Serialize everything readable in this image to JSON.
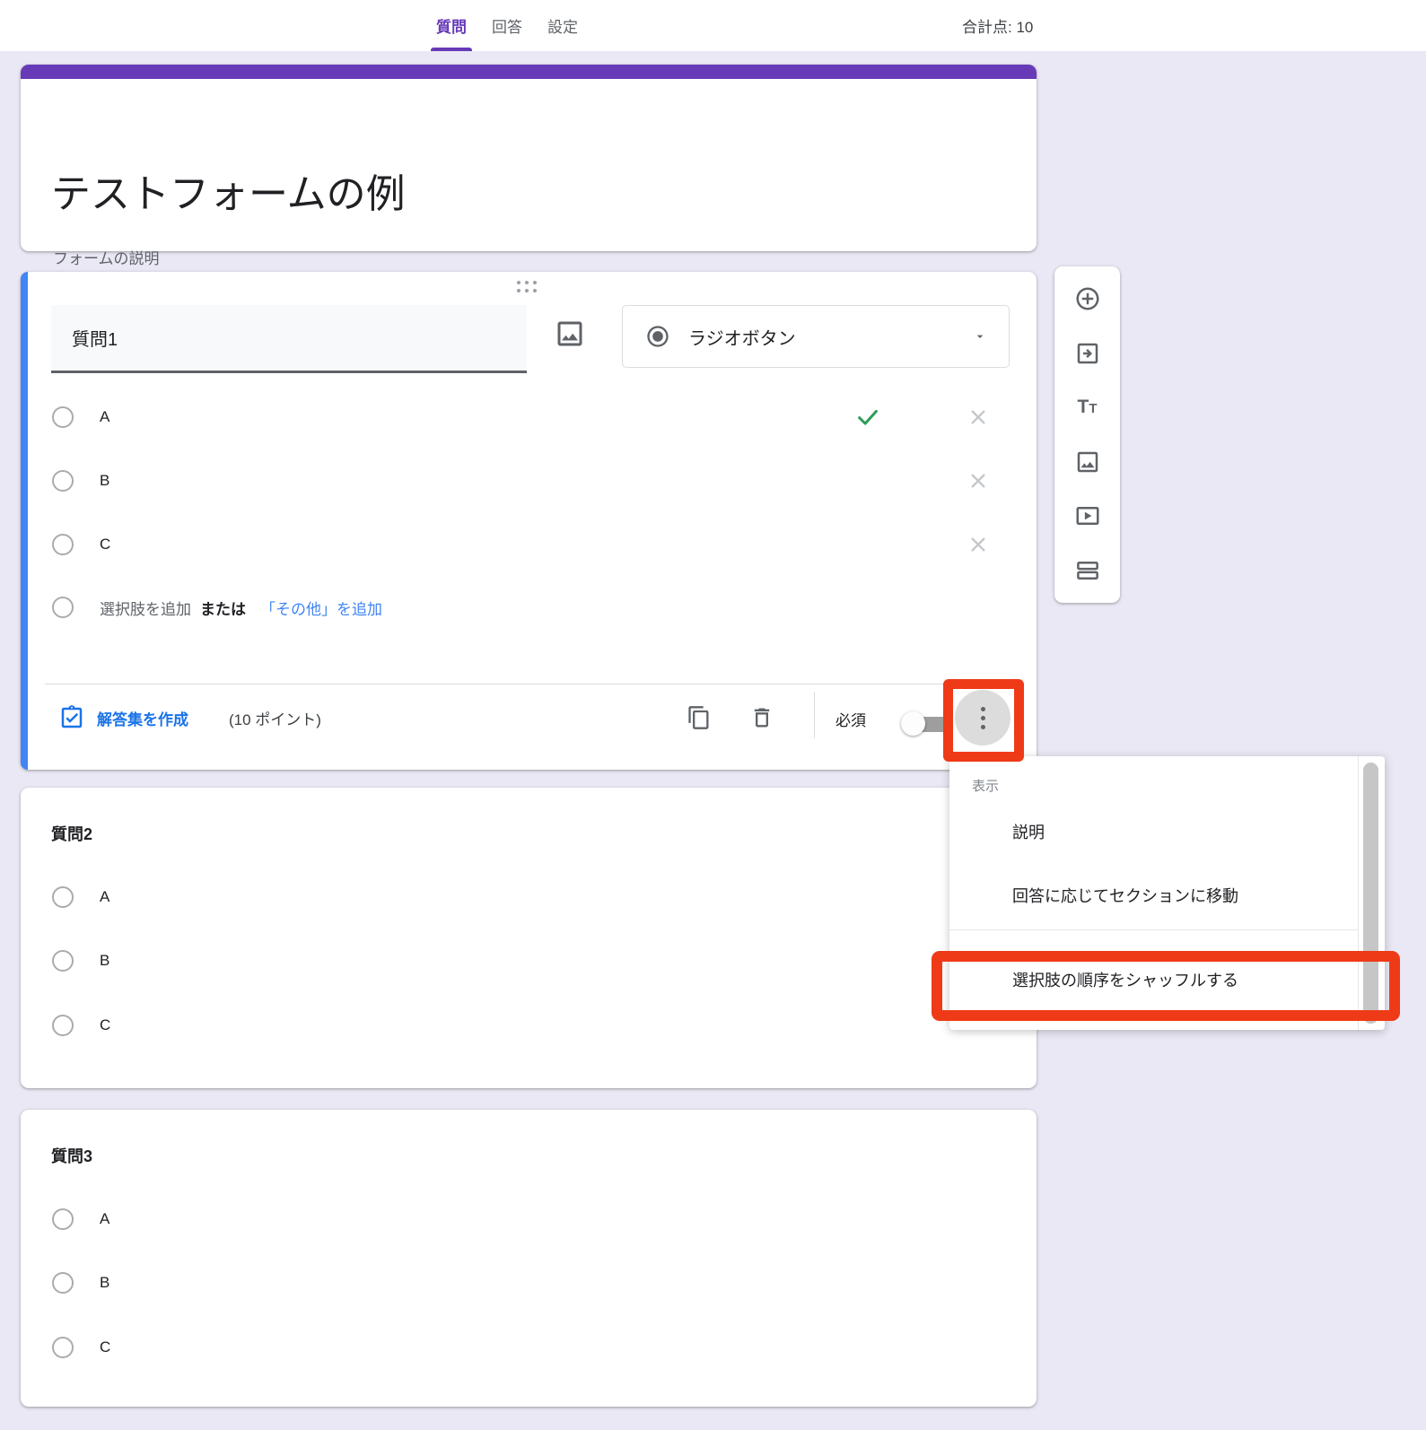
{
  "topbar": {
    "tabs": [
      {
        "label": "質問"
      },
      {
        "label": "回答"
      },
      {
        "label": "設定"
      }
    ],
    "total_points": "合計点: 10"
  },
  "form_header": {
    "title": "テストフォームの例",
    "description": "フォームの説明"
  },
  "question1": {
    "title": "質問1",
    "type_label": "ラジオボタン",
    "options": [
      {
        "label": "A",
        "correct": true
      },
      {
        "label": "B",
        "correct": false
      },
      {
        "label": "C",
        "correct": false
      }
    ],
    "add_option_label": "選択肢を追加",
    "or_label": "または",
    "add_other_label": "「その他」を追加",
    "answer_key_label": "解答集を作成",
    "points_label": "(10 ポイント)",
    "required_label": "必須"
  },
  "question2": {
    "title": "質問2",
    "options": [
      {
        "label": "A"
      },
      {
        "label": "B"
      },
      {
        "label": "C"
      }
    ]
  },
  "question3": {
    "title": "質問3",
    "options": [
      {
        "label": "A"
      },
      {
        "label": "B"
      },
      {
        "label": "C"
      }
    ]
  },
  "context_menu": {
    "section_header": "表示",
    "item_description": "説明",
    "item_go_to_section": "回答に応じてセクションに移動",
    "item_shuffle": "選択肢の順序をシャッフルする"
  },
  "colors": {
    "theme_purple": "#673AB7",
    "active_card_blue": "#4285F4",
    "link_blue": "#1A73E8",
    "correct_green": "#2E9C58",
    "annotation_red": "#EF3A17"
  }
}
